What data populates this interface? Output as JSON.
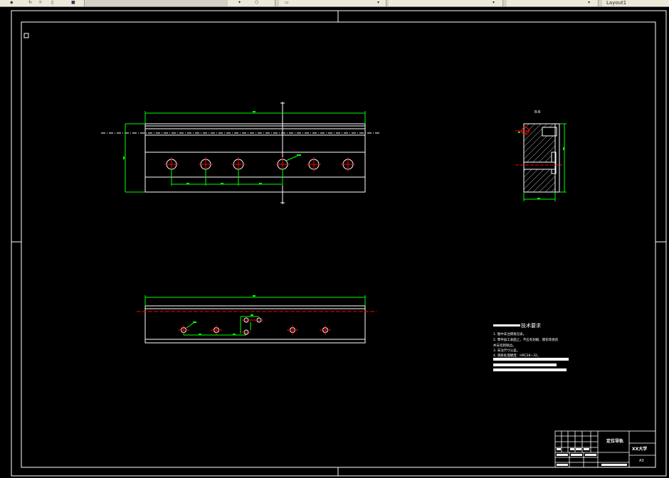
{
  "toolbar": {
    "right_label": "Layout1"
  },
  "drawing": {
    "section_label": "B-B",
    "tech_title": "技术要求",
    "tech_notes": [
      "1. 图中未注倒角见表。",
      "2. 零件加工表面上，不应有划痕、擦伤等损伤",
      "   并去毛刺锐边。",
      "3. 未注尺寸公差。",
      "4. 调质处理硬度：HRC28~32。"
    ],
    "title_block": {
      "part_name": "定位导轨",
      "company": "XX大学",
      "sheet_code": "A3"
    }
  },
  "colors": {
    "background": "#000000",
    "lines": "#ffffff",
    "dimensions": "#00ff00",
    "centerlines": "#ff0000"
  }
}
